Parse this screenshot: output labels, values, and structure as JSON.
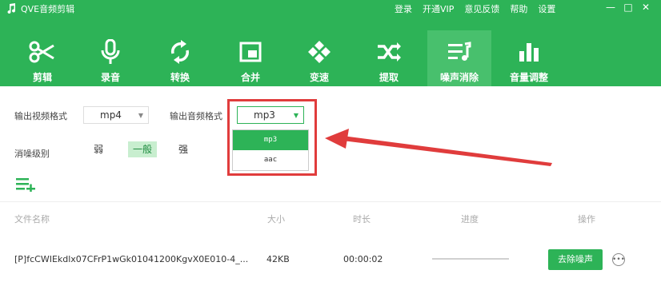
{
  "app": {
    "title": "QVE音频剪辑"
  },
  "top_menu": [
    "登录",
    "开通VIP",
    "意见反馈",
    "帮助",
    "设置"
  ],
  "toolbar": [
    {
      "label": "剪辑",
      "icon": "scissors-icon"
    },
    {
      "label": "录音",
      "icon": "microphone-icon"
    },
    {
      "label": "转换",
      "icon": "convert-icon"
    },
    {
      "label": "合并",
      "icon": "merge-icon"
    },
    {
      "label": "变速",
      "icon": "speed-icon"
    },
    {
      "label": "提取",
      "icon": "extract-icon"
    },
    {
      "label": "噪声消除",
      "icon": "noise-reduction-icon",
      "active": true
    },
    {
      "label": "音量调整",
      "icon": "volume-adjust-icon"
    }
  ],
  "settings": {
    "video_format_label": "输出视频格式",
    "video_format_value": "mp4",
    "audio_format_label": "输出音频格式",
    "audio_format_value": "mp3",
    "audio_format_options": [
      "mp3",
      "aac"
    ],
    "noise_level_label": "消噪级别",
    "noise_levels": [
      "弱",
      "一般",
      "强"
    ],
    "noise_level_selected": "一般"
  },
  "table": {
    "headers": [
      "文件名称",
      "大小",
      "时长",
      "进度",
      "操作"
    ],
    "rows": [
      {
        "name": "[P]fcCWIEkdlx07CFrP1wGk01041200KgvX0E010-4_...",
        "size": "42KB",
        "duration": "00:00:02",
        "progress": 0,
        "action": "去除噪声"
      }
    ]
  },
  "colors": {
    "brand": "#2db357",
    "highlight": "#e03c3c"
  }
}
